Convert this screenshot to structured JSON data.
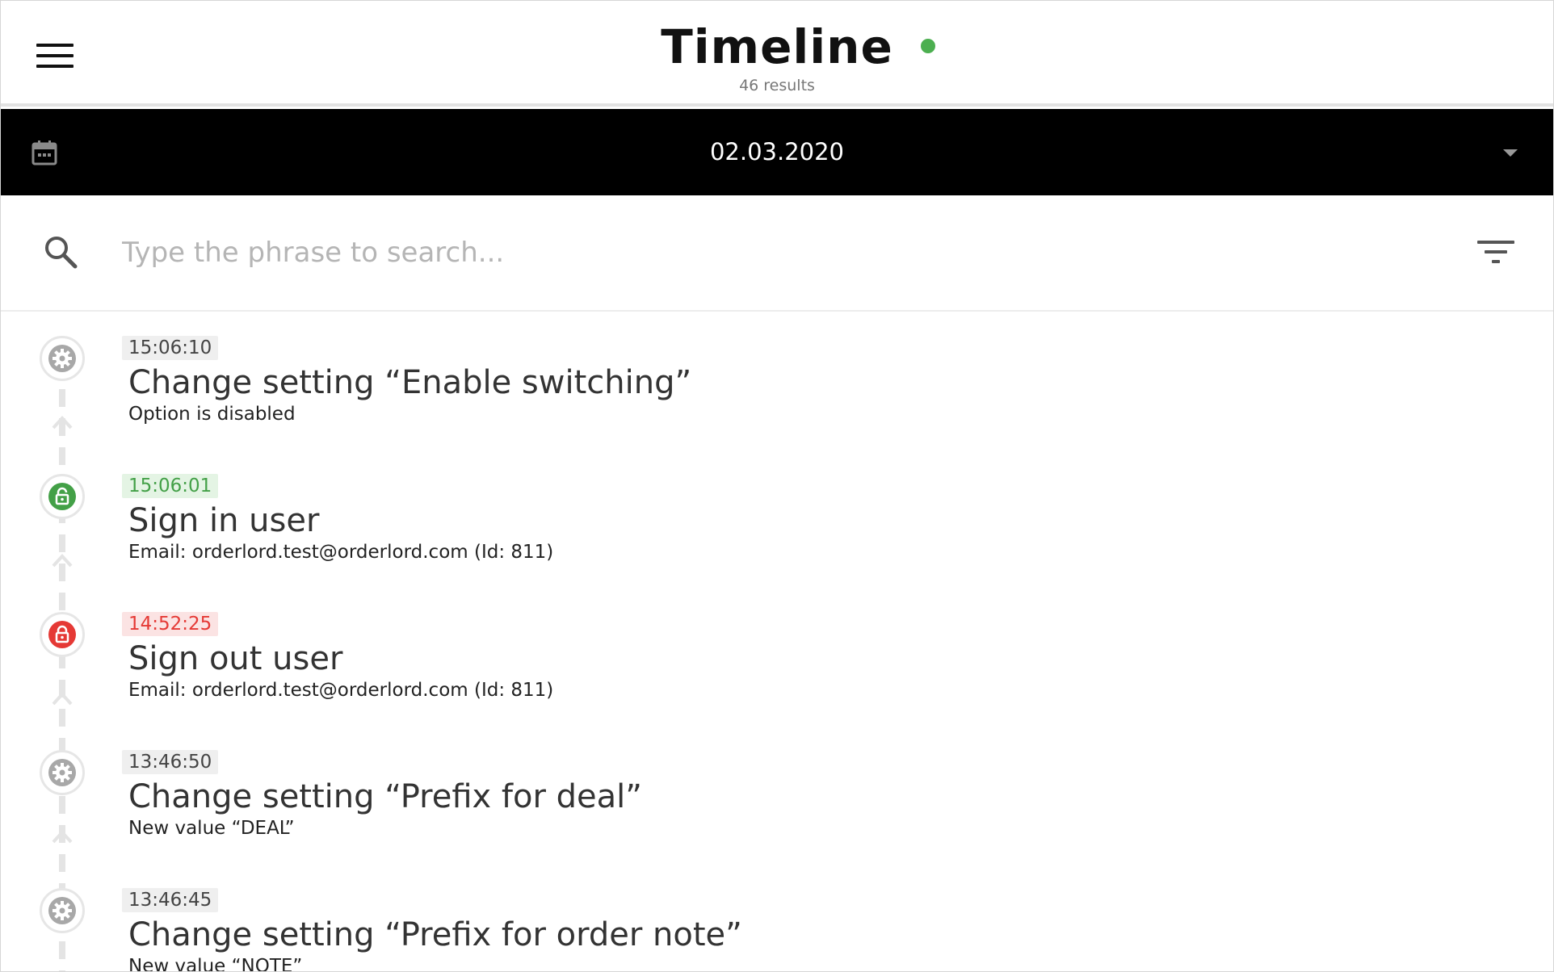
{
  "header": {
    "title": "Timeline",
    "status_color": "#4caf50",
    "results": "46 results"
  },
  "date_picker": {
    "value": "02.03.2020"
  },
  "search": {
    "placeholder": "Type the phrase to search..."
  },
  "colors": {
    "neutral": "#a8a8a8",
    "success": "#43a047",
    "danger": "#e53935",
    "neutral_badge_bg": "#efefef",
    "success_badge_bg": "#e4f4e4",
    "danger_badge_bg": "#fbe3e3"
  },
  "events": [
    {
      "time": "15:06:10",
      "title": "Change setting “Enable switching”",
      "description": "Option is disabled",
      "icon": "gear-icon",
      "status": "neutral"
    },
    {
      "time": "15:06:01",
      "title": "Sign in user",
      "description": "Email: orderlord.test@orderlord.com (Id: 811)",
      "icon": "unlock-icon",
      "status": "success"
    },
    {
      "time": "14:52:25",
      "title": "Sign out user",
      "description": "Email: orderlord.test@orderlord.com (Id: 811)",
      "icon": "lock-icon",
      "status": "danger"
    },
    {
      "time": "13:46:50",
      "title": "Change setting “Prefix for deal”",
      "description": "New value “DEAL”",
      "icon": "gear-icon",
      "status": "neutral"
    },
    {
      "time": "13:46:45",
      "title": "Change setting “Prefix for order note”",
      "description": "New value “NOTE”",
      "icon": "gear-icon",
      "status": "neutral"
    }
  ]
}
